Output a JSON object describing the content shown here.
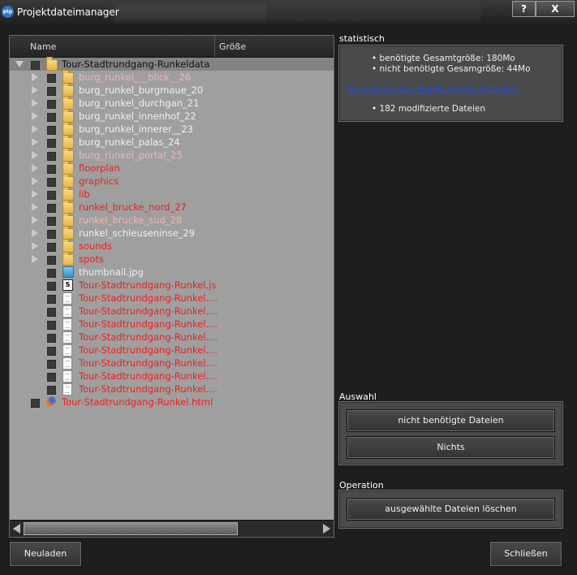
{
  "window": {
    "title": "Projektdateimanager",
    "app_icon_text": "ptp",
    "help_label": "?",
    "close_label": "X"
  },
  "tree": {
    "columns": {
      "name": "Name",
      "size": "Größe"
    },
    "root": "Tour-Stadtrundgang-Runkeldata",
    "items": [
      {
        "name": "burg_runkel___blick__26",
        "type": "folder",
        "color": "pink"
      },
      {
        "name": "burg_runkel_burgmaue_20",
        "type": "folder",
        "color": "grey"
      },
      {
        "name": "burg_runkel_durchgan_21",
        "type": "folder",
        "color": "grey"
      },
      {
        "name": "burg_runkel_innenhof_22",
        "type": "folder",
        "color": "grey"
      },
      {
        "name": "burg_runkel_innerer__23",
        "type": "folder",
        "color": "grey"
      },
      {
        "name": "burg_runkel_palas_24",
        "type": "folder",
        "color": "grey"
      },
      {
        "name": "burg_runkel_portal_25",
        "type": "folder",
        "color": "pink"
      },
      {
        "name": "floorplan",
        "type": "folder",
        "color": "red"
      },
      {
        "name": "graphics",
        "type": "folder",
        "color": "red"
      },
      {
        "name": "lib",
        "type": "folder",
        "color": "red"
      },
      {
        "name": "runkel_brucke_nord_27",
        "type": "folder",
        "color": "red"
      },
      {
        "name": "runkel_brucke_sud_28",
        "type": "folder",
        "color": "pink"
      },
      {
        "name": "runkel_schleuseninse_29",
        "type": "folder",
        "color": "grey"
      },
      {
        "name": "sounds",
        "type": "folder",
        "color": "red"
      },
      {
        "name": "spots",
        "type": "folder",
        "color": "red"
      },
      {
        "name": "thumbnail.jpg",
        "type": "image",
        "color": "grey"
      },
      {
        "name": "Tour-Stadtrundgang-Runkel.js",
        "type": "js",
        "color": "red"
      },
      {
        "name": "Tour-Stadtrundgang-Runkel....",
        "type": "doc",
        "color": "red"
      },
      {
        "name": "Tour-Stadtrundgang-Runkel....",
        "type": "doc",
        "color": "red"
      },
      {
        "name": "Tour-Stadtrundgang-Runkel....",
        "type": "doc",
        "color": "red"
      },
      {
        "name": "Tour-Stadtrundgang-Runkel....",
        "type": "doc",
        "color": "red"
      },
      {
        "name": "Tour-Stadtrundgang-Runkel....",
        "type": "doc",
        "color": "red"
      },
      {
        "name": "Tour-Stadtrundgang-Runkel....",
        "type": "doc",
        "color": "red"
      },
      {
        "name": "Tour-Stadtrundgang-Runkel....",
        "type": "doc",
        "color": "red"
      },
      {
        "name": "Tour-Stadtrundgang-Runkel....",
        "type": "doc",
        "color": "red"
      }
    ],
    "root_file": "Tour-Stadtrundgang-Runkel.html"
  },
  "statistics": {
    "label": "statistisch",
    "required_size": "benötigte Gesamtgröße: 180Mo",
    "unneeded_size": "nicht benötigte Gesamgröße: 44Mo",
    "rebuild_link": "Sie müssen das Projekt erneut erstellen.",
    "modified_files": "182 modifizierte Dateien"
  },
  "selection": {
    "label": "Auswahl",
    "unneeded_button": "nicht benötigte Dateien",
    "none_button": "Nichts"
  },
  "operation": {
    "label": "Operation",
    "delete_button": "ausgewählte Dateien löschen"
  },
  "footer": {
    "reload_button": "Neuladen",
    "close_button": "Schließen"
  },
  "colors": {
    "pink": "#f2b4b4",
    "grey": "#f0f0f0",
    "red": "#f01e1e",
    "link": "#1e4ef5"
  }
}
